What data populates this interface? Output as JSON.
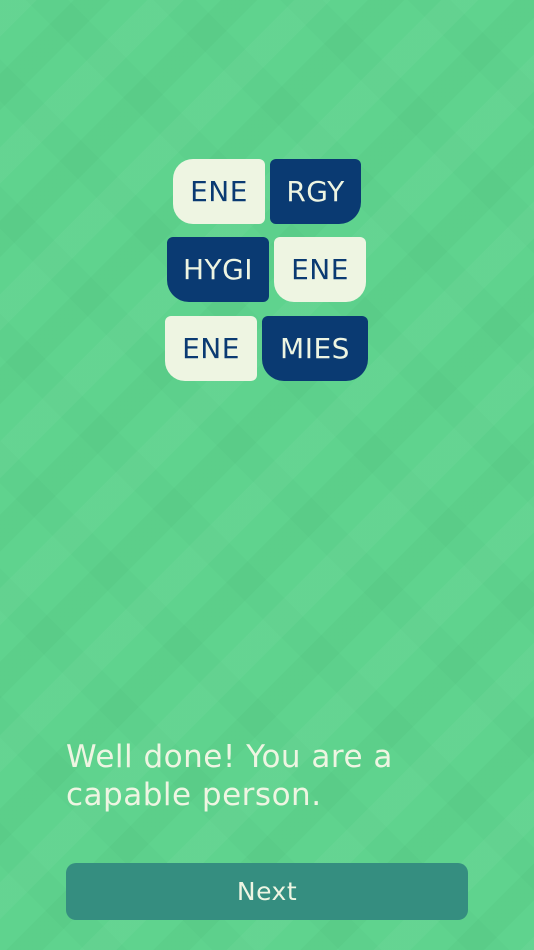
{
  "tiles": {
    "row1": [
      {
        "text": "ENE",
        "style": "light"
      },
      {
        "text": "RGY",
        "style": "dark"
      }
    ],
    "row2": [
      {
        "text": "HYGI",
        "style": "dark"
      },
      {
        "text": "ENE",
        "style": "light"
      }
    ],
    "row3": [
      {
        "text": "ENE",
        "style": "light"
      },
      {
        "text": "MIES",
        "style": "dark"
      }
    ]
  },
  "message": "Well done! You are a capable person.",
  "next_button_label": "Next",
  "colors": {
    "background": "#5fd38e",
    "tile_light": "#eef5e2",
    "tile_dark": "#0a3a72",
    "button": "#358e80",
    "text_light": "#eef5e2"
  }
}
